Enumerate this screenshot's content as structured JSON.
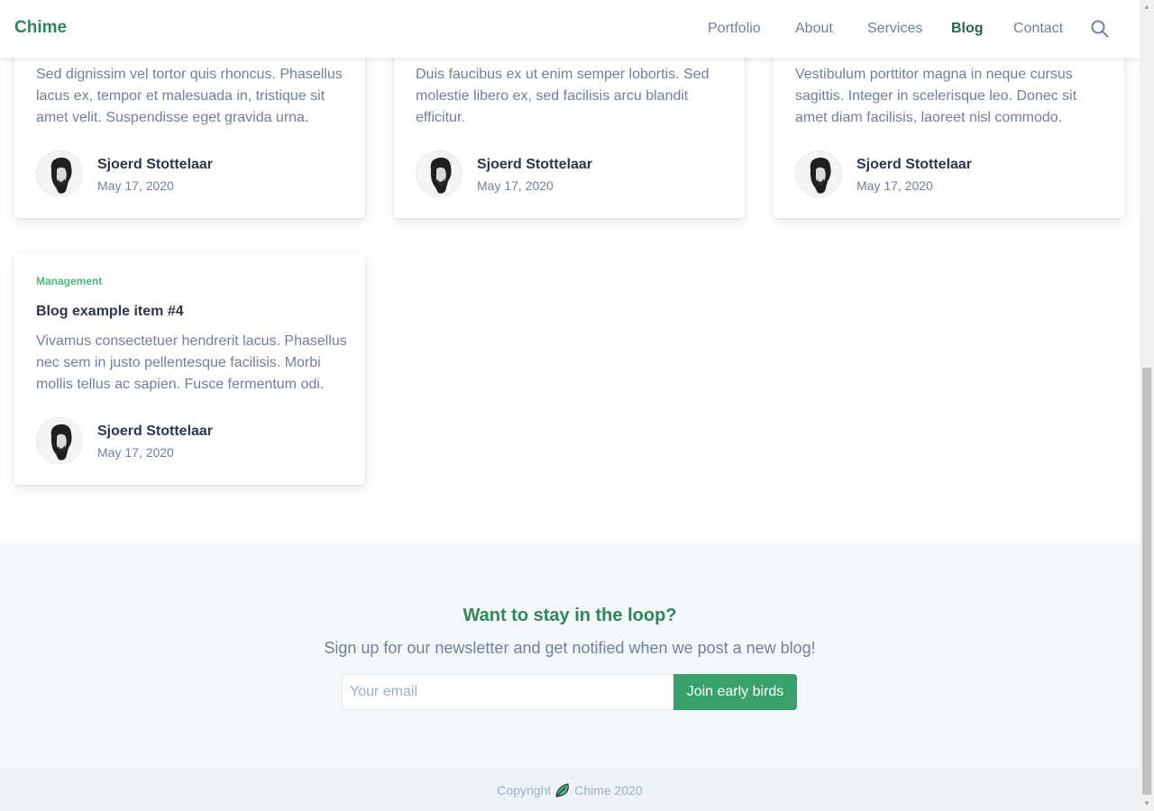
{
  "navbar": {
    "brand": "Chime",
    "links": [
      {
        "label": "Portfolio",
        "active": false
      },
      {
        "label": "About",
        "active": false
      },
      {
        "label": "Services",
        "active": false
      },
      {
        "label": "Blog",
        "active": true
      },
      {
        "label": "Contact",
        "active": false
      }
    ],
    "search_icon": "search-icon"
  },
  "cards": [
    {
      "excerpt": "Sed dignissim vel tortor quis rhoncus. Phasellus lacus ex, tempor et malesuada in, tristique sit amet velit. Suspendisse eget gravida urna.",
      "author": "Sjoerd Stottelaar",
      "date": "May 17, 2020"
    },
    {
      "excerpt": "Duis faucibus ex ut enim semper lobortis. Sed molestie libero ex, sed facilisis arcu blandit efficitur.",
      "author": "Sjoerd Stottelaar",
      "date": "May 17, 2020"
    },
    {
      "excerpt": "Vestibulum porttitor magna in neque cursus sagittis. Integer in scelerisque leo. Donec sit amet diam facilisis, laoreet nisl commodo.",
      "author": "Sjoerd Stottelaar",
      "date": "May 17, 2020"
    },
    {
      "category": "Management",
      "title": "Blog example item #4",
      "excerpt": "Vivamus consectetuer hendrerit lacus. Phasellus nec sem in justo pellentesque facilisis. Morbi mollis tellus ac sapien. Fusce fermentum odi.",
      "author": "Sjoerd Stottelaar",
      "date": "May 17, 2020"
    }
  ],
  "newsletter": {
    "heading": "Want to stay in the loop?",
    "subheading": "Sign up for our newsletter and get notified when we post a new blog!",
    "email_placeholder": "Your email",
    "email_value": "",
    "button_label": "Join early birds"
  },
  "footer": {
    "copyright_label": "Copyright",
    "brand_year": "Chime 2020",
    "logo_icon": "leaf-icon"
  },
  "colors": {
    "brand": "#2f855a",
    "accent": "#38a169",
    "category": "#48bb78",
    "active_nav": "#276749"
  }
}
